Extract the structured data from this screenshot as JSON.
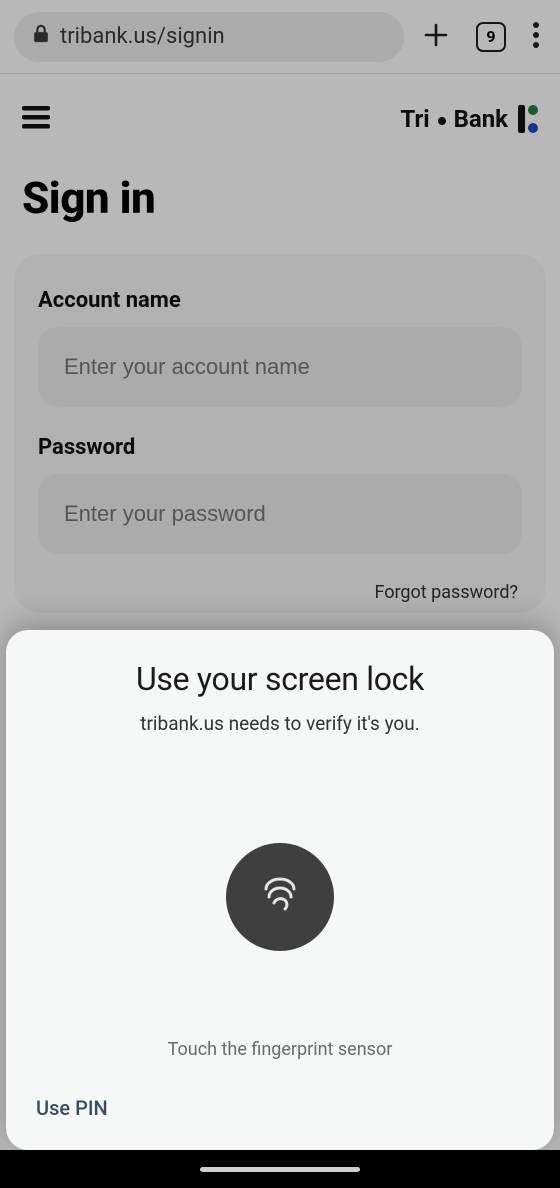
{
  "browser": {
    "url": "tribank.us/signin",
    "tab_count": "9"
  },
  "header": {
    "brand_left": "Tri",
    "brand_right": "Bank"
  },
  "page": {
    "title": "Sign in"
  },
  "form": {
    "account_label": "Account name",
    "account_placeholder": "Enter your account name",
    "account_value": "",
    "password_label": "Password",
    "password_placeholder": "Enter your password",
    "password_value": "",
    "forgot_label": "Forgot password?"
  },
  "sheet": {
    "title": "Use your screen lock",
    "subtitle": "tribank.us needs to verify it's you.",
    "hint": "Touch the fingerprint sensor",
    "alt_action": "Use PIN"
  }
}
